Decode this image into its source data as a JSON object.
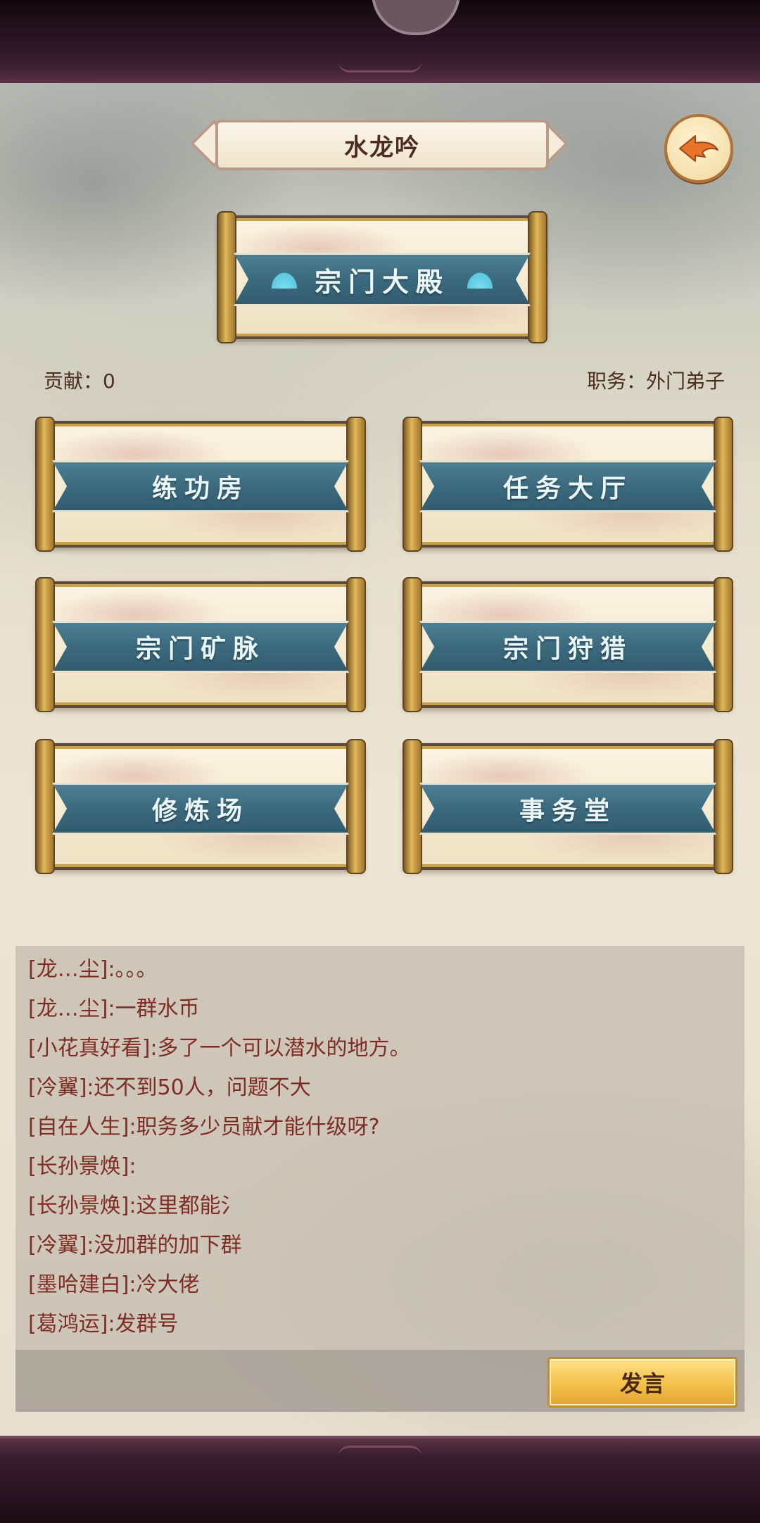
{
  "header": {
    "title": "水龙吟"
  },
  "hall": {
    "label": "宗门大殿"
  },
  "stats": {
    "contribution": "贡献：0",
    "position": "职务：外门弟子"
  },
  "facilities": [
    {
      "label": "练功房"
    },
    {
      "label": "任务大厅"
    },
    {
      "label": "宗门矿脉"
    },
    {
      "label": "宗门狩猎"
    },
    {
      "label": "修炼场"
    },
    {
      "label": "事务堂"
    }
  ],
  "chat": {
    "messages": [
      "[龙…尘]:。。。",
      "[龙…尘]:一群水币",
      "[小花真好看]:多了一个可以潜水的地方。",
      "[冷翼]:还不到50人，问题不大",
      "[自在人生]:职务多少员献才能什级呀?",
      "[长孙景焕]:",
      "[长孙景焕]:这里都能氵",
      "[冷翼]:没加群的加下群",
      "[墨哈建白]:冷大佬",
      "[葛鸿运]:发群号"
    ],
    "send_label": "发言"
  },
  "icons": {
    "back": "back-arrow-icon",
    "fan": "fan-icon",
    "mascot": "mascot-icon"
  },
  "colors": {
    "ribbon": "#3b6a7e",
    "gold": "#d9ad52",
    "chat_text": "#7e2c24",
    "send_button": "#f4c04a"
  }
}
